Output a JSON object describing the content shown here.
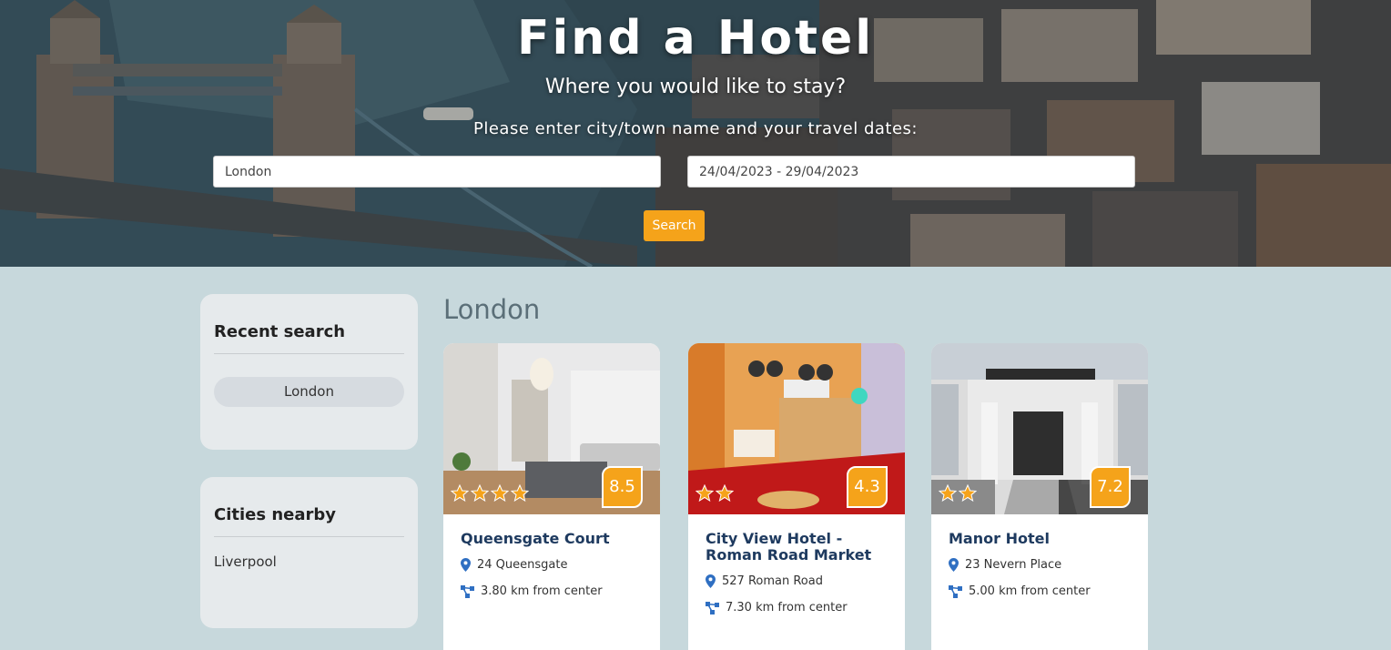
{
  "hero": {
    "title": "Find a Hotel",
    "subtitle": "Where you would like to stay?",
    "prompt": "Please enter city/town name and your travel dates:",
    "city_value": "London",
    "dates_value": "24/04/2023 - 29/04/2023",
    "search_label": "Search"
  },
  "sidebar": {
    "recent": {
      "title": "Recent search",
      "items": [
        "London"
      ]
    },
    "nearby": {
      "title": "Cities nearby",
      "items": [
        "Liverpool"
      ]
    }
  },
  "results": {
    "title": "London",
    "hotels": [
      {
        "name": "Queensgate Court",
        "address": "24 Queensgate",
        "distance": "3.80 km from center",
        "rating": "8.5",
        "stars": 4
      },
      {
        "name": "City View Hotel - Roman Road Market",
        "address": "527 Roman Road",
        "distance": "7.30 km from center",
        "rating": "4.3",
        "stars": 2
      },
      {
        "name": "Manor Hotel",
        "address": "23 Nevern Place",
        "distance": "5.00 km from center",
        "rating": "7.2",
        "stars": 2
      }
    ]
  },
  "colors": {
    "accent": "#f5a31a",
    "page_background": "#c7d8dc",
    "panel": "#e6eaec",
    "hotel_name": "#1e3a5f",
    "icon": "#2f6fc2"
  },
  "icons": {
    "address": "map-pin-icon",
    "distance": "route-icon",
    "star": "star-icon"
  }
}
